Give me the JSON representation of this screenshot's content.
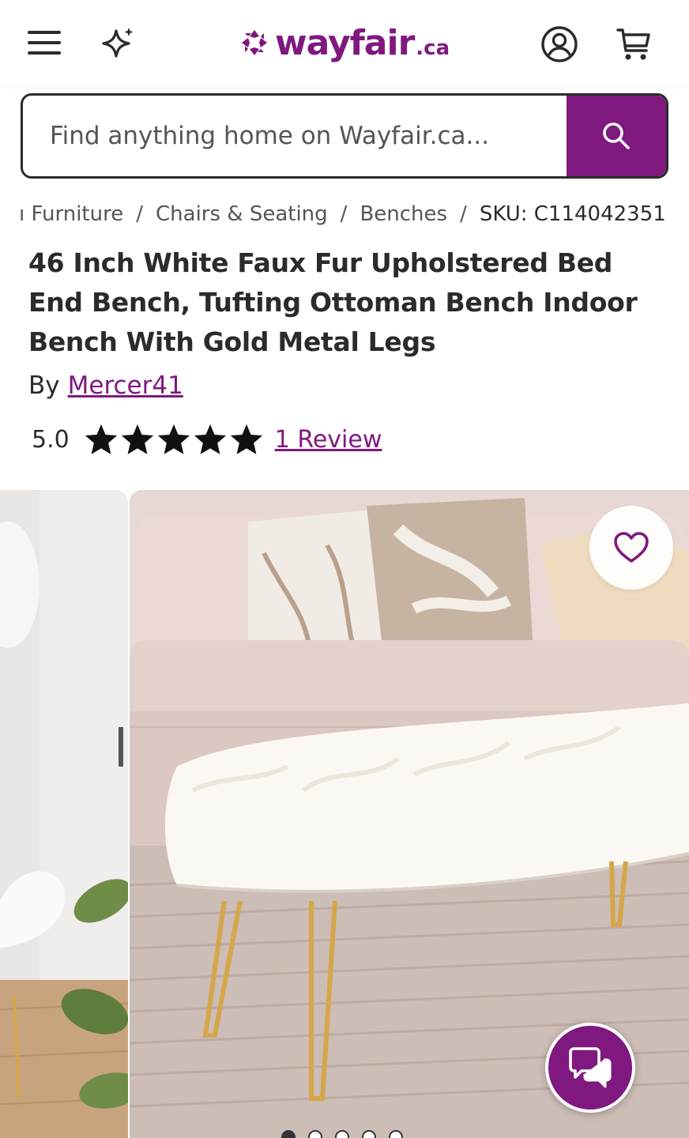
{
  "header": {
    "logo_word": "wayfair",
    "logo_tld": ".ca",
    "brand_color": "#7f187f",
    "icons": [
      "hamburger-menu-icon",
      "sparkle-icon",
      "account-icon",
      "cart-icon"
    ]
  },
  "search": {
    "placeholder": "Find anything home on Wayfair.ca..."
  },
  "breadcrumb": {
    "items": [
      "ı Furniture",
      "Chairs & Seating",
      "Benches"
    ],
    "sku": "SKU: C114042351"
  },
  "product": {
    "title": "46 Inch White Faux Fur Upholstered Bed End Bench, Tufting Ottoman Bench Indoor Bench With Gold Metal Legs",
    "by_label": "By",
    "brand": "Mercer41",
    "rating": "5.0",
    "stars": 5,
    "reviews_label": "1 Review"
  },
  "gallery": {
    "dots": 5,
    "active_dot": 0
  }
}
